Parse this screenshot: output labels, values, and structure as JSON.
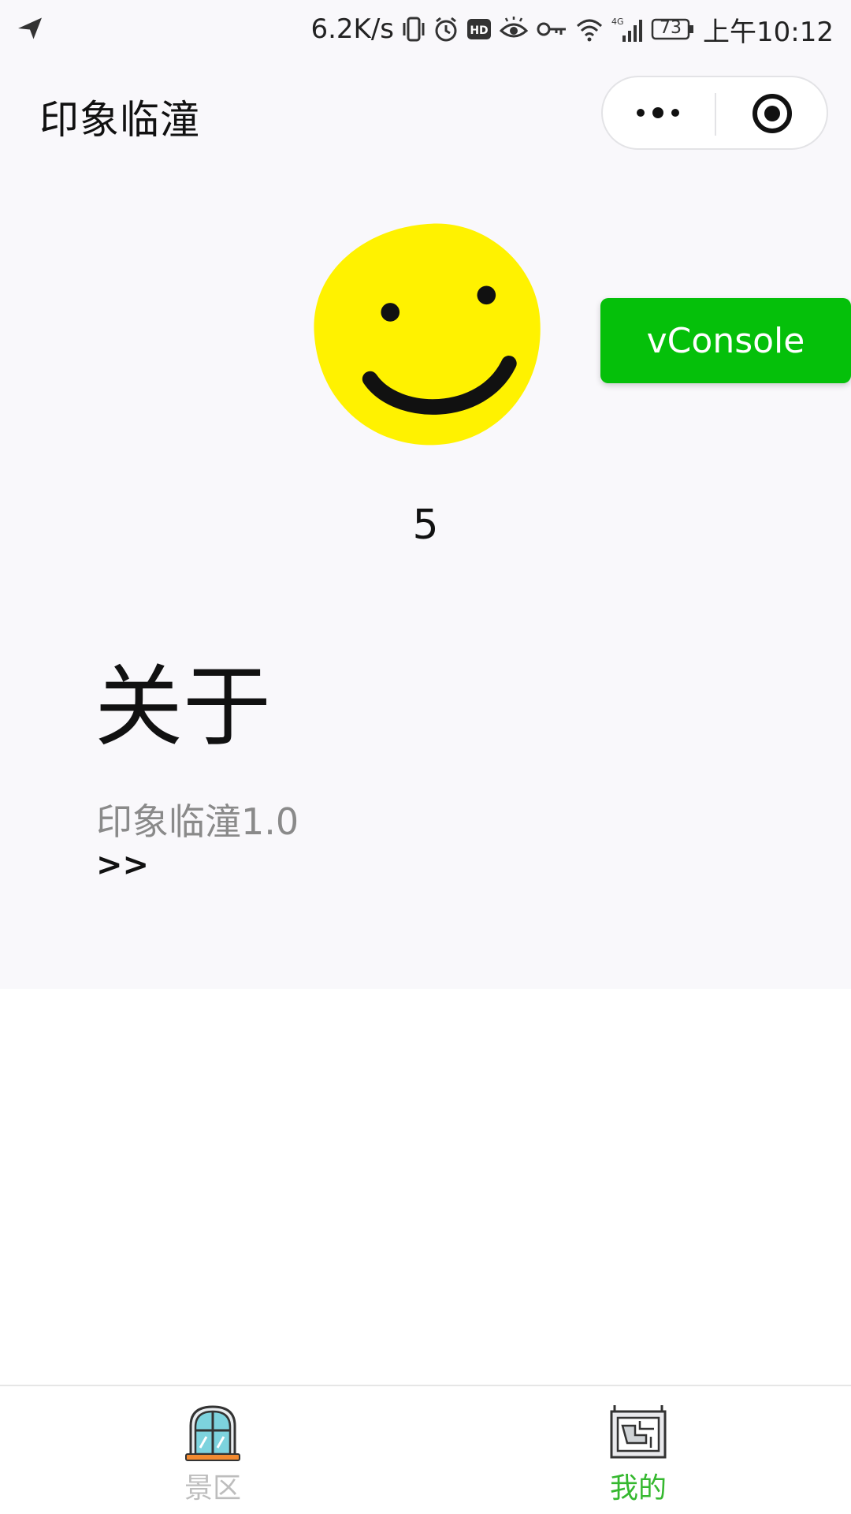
{
  "status_bar": {
    "net_speed": "6.2K/s",
    "battery": "73",
    "time": "上午10:12"
  },
  "nav": {
    "title": "印象临潼"
  },
  "profile": {
    "count": "5"
  },
  "about": {
    "title": "关于",
    "version": "印象临潼1.0",
    "more": ">>"
  },
  "vconsole": {
    "label": "vConsole",
    "color": "#05c00a"
  },
  "tabs": [
    {
      "label": "景区",
      "icon": "window-icon",
      "active": false
    },
    {
      "label": "我的",
      "icon": "map-board-icon",
      "active": true
    }
  ],
  "colors": {
    "active_tab": "#35b82f",
    "inactive_tab": "#bdbdbd",
    "background": "#f9f8fb"
  }
}
